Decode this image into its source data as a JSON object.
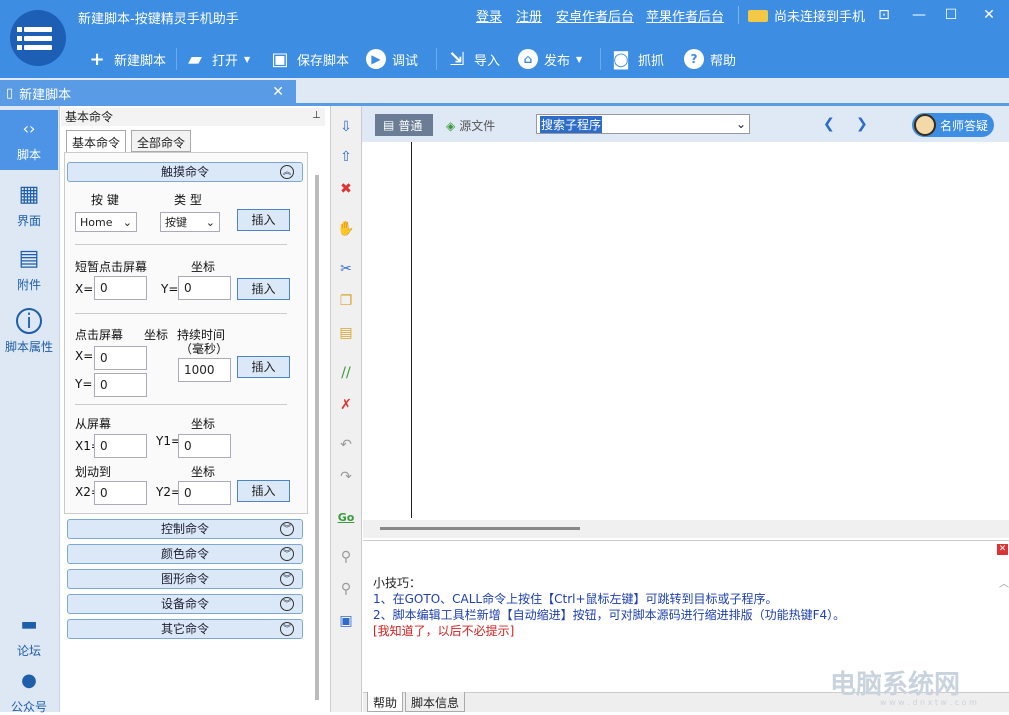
{
  "app": {
    "title": "新建脚本-按键精灵手机助手"
  },
  "toplinks": [
    "登录",
    "注册",
    "安卓作者后台",
    "苹果作者后台"
  ],
  "connection": "尚未连接到手机",
  "toolbar": {
    "new": "新建脚本",
    "open": "打开",
    "save": "保存脚本",
    "debug": "调试",
    "import": "导入",
    "publish": "发布",
    "capture": "抓抓",
    "help": "帮助"
  },
  "doc_tab": "新建脚本",
  "nav": {
    "script": "脚本",
    "ui": "界面",
    "attach": "附件",
    "props": "脚本属性",
    "forum": "论坛",
    "wechat": "公众号"
  },
  "cmd": {
    "header": "基本命令",
    "tab_basic": "基本命令",
    "tab_all": "全部命令",
    "touch": "触摸命令",
    "key_label": "按 键",
    "type_label": "类 型",
    "key_value": "Home",
    "type_value": "按键",
    "insert": "插入",
    "tap_label": "短暂点击屏幕",
    "coord": "坐标",
    "x_label": "X=",
    "y_label": "Y=",
    "x1_label": "X1=",
    "y1_label": "Y1=",
    "x2_label": "X2=",
    "y2_label": "Y2=",
    "zero": "0",
    "press_label": "点击屏幕",
    "duration_label": "持续时间",
    "duration_unit": "（毫秒）",
    "duration_value": "1000",
    "swipe_from": "从屏幕",
    "swipe_to": "划动到",
    "control": "控制命令",
    "color": "颜色命令",
    "graphic": "图形命令",
    "device": "设备命令",
    "other": "其它命令"
  },
  "editor": {
    "mode_normal": "普通",
    "mode_source": "源文件",
    "search": "搜索子程序",
    "teacher": "名师答疑"
  },
  "tips": {
    "title": "小技巧：",
    "line1": "1、在GOTO、CALL命令上按住【Ctrl+鼠标左键】可跳转到目标或子程序。",
    "line2": "2、脚本编辑工具栏新增【自动缩进】按钮，可对脚本源码进行缩进排版（功能热键F4）。",
    "dismiss": "[我知道了，以后不必提示]"
  },
  "bottom_tabs": [
    "帮助",
    "脚本信息"
  ],
  "watermark": {
    "text": "电脑系统网",
    "url": "w w w . d n x t w . c o m"
  }
}
